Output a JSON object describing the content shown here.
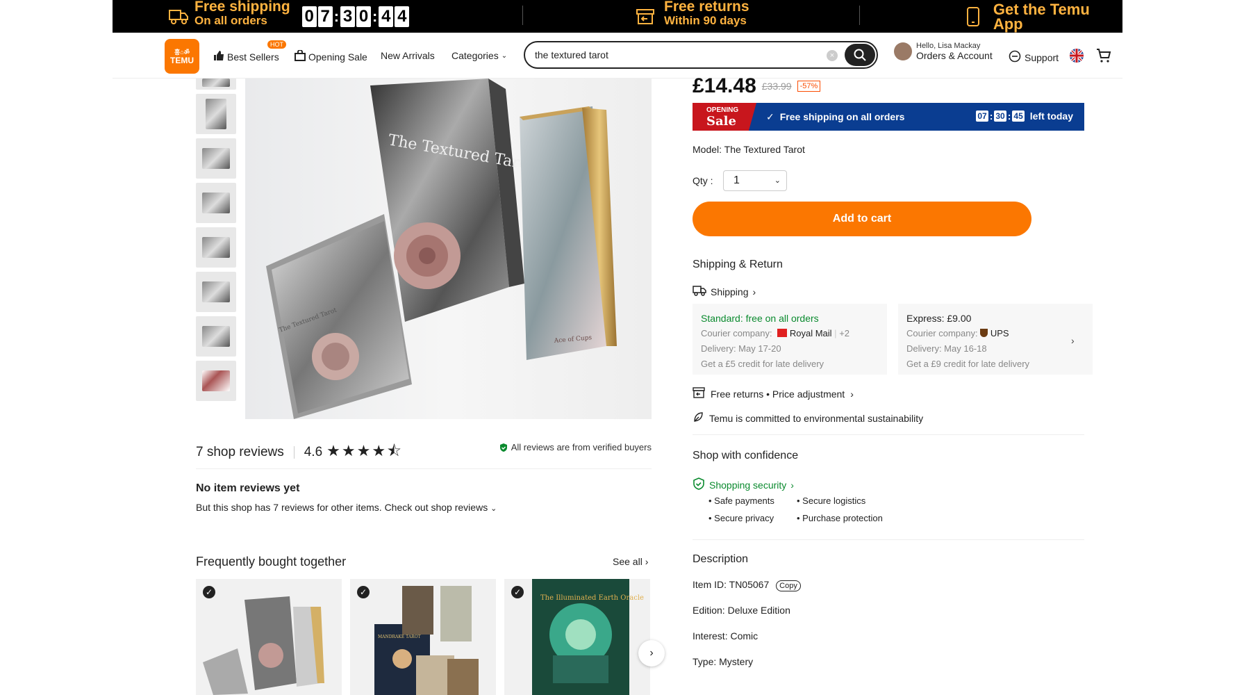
{
  "banner": {
    "shipping_title": "Free shipping",
    "shipping_sub": "On all orders",
    "timer_digits": [
      "0",
      "7",
      "3",
      "0",
      "4",
      "4"
    ],
    "returns_title": "Free returns",
    "returns_sub": "Within 90 days",
    "app_text": "Get the Temu App",
    "color": "#ffb340"
  },
  "header": {
    "logo_top": "홍⌂ॐ",
    "logo_text": "TEMU",
    "nav": {
      "best_sellers": "Best Sellers",
      "hot_badge": "HOT",
      "opening_sale": "Opening Sale",
      "new_arrivals": "New Arrivals",
      "categories": "Categories"
    },
    "search_value": "the textured tarot",
    "account_greeting": "Hello, Lisa Mackay",
    "account_label": "Orders & Account",
    "support": "Support"
  },
  "product": {
    "price": "£14.48",
    "was_price": "£33.99",
    "discount": "-57%",
    "sale_badge_top": "OPENING",
    "sale_badge_main": "Sale",
    "free_shipping": "Free shipping on all orders",
    "timer": [
      "07",
      "30",
      "45"
    ],
    "left_today": "left today",
    "model": "Model: The Textured Tarot",
    "qty_label": "Qty :",
    "qty_value": "1",
    "add_to_cart": "Add to cart",
    "accent_color": "#fb7701"
  },
  "shipping": {
    "section_title": "Shipping & Return",
    "shipping_link": "Shipping",
    "standard": {
      "head": "Standard: free on all orders",
      "courier_label": "Courier company:",
      "courier": "Royal Mail",
      "courier_more": "+2",
      "delivery": "Delivery: May 17-20",
      "credit": "Get a £5 credit for late delivery"
    },
    "express": {
      "head": "Express: £9.00",
      "courier_label": "Courier company:",
      "courier": "UPS",
      "delivery": "Delivery: May 16-18",
      "credit": "Get a £9 credit for late delivery"
    },
    "returns": "Free returns • Price adjustment",
    "environment": "Temu is committed to environmental sustainability"
  },
  "confidence": {
    "title": "Shop with confidence",
    "security_link": "Shopping security",
    "bullets": [
      "Safe payments",
      "Secure logistics",
      "Secure privacy",
      "Purchase protection"
    ]
  },
  "description": {
    "title": "Description",
    "item_id": "Item ID: TN05067",
    "copy": "Copy",
    "edition": "Edition: Deluxe Edition",
    "interest": "Interest: Comic",
    "type": "Type: Mystery"
  },
  "reviews": {
    "title": "7 shop reviews",
    "score": "4.6",
    "stars": "★★★★⯪",
    "verified": "All reviews are from verified buyers",
    "no_item_title": "No item reviews yet",
    "no_item_text": "But this shop has 7 reviews for other items. Check out shop reviews"
  },
  "fbt": {
    "title": "Frequently bought together",
    "see_all": "See all"
  },
  "product_image_text": {
    "box_title": "The Textured Tarot",
    "book_title": "The Textured Tarot",
    "card_caption": "Ace of Cups",
    "fbt2_text": "MANDRAKE TAROT",
    "fbt3_text": "The Illuminated Earth Oracle"
  }
}
